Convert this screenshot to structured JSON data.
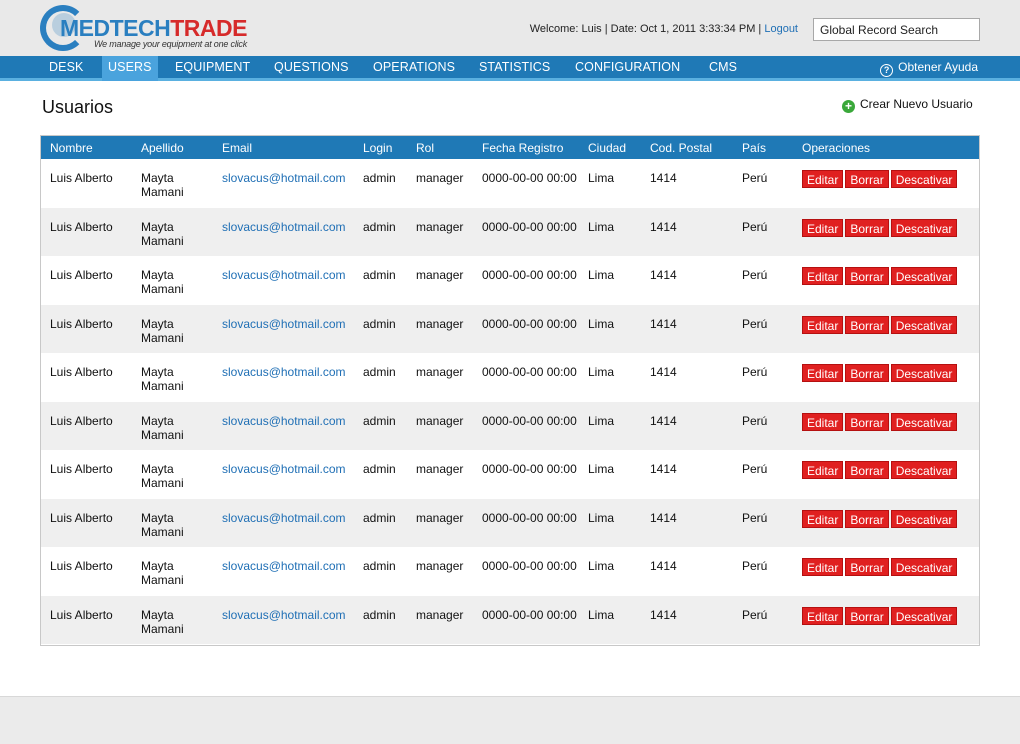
{
  "logo": {
    "brand_main": "MEDTECH",
    "brand_accent": "TRADE",
    "tagline": "We manage your equipment at one click"
  },
  "header": {
    "welcome": "Welcome: Luis | Date: Oct 1, 2011 3:33:34 PM |",
    "logout": "Logout",
    "search_value": "Global Record Search"
  },
  "nav": {
    "items": [
      {
        "label": "DESK"
      },
      {
        "label": "USERS"
      },
      {
        "label": "EQUIPMENT"
      },
      {
        "label": "QUESTIONS"
      },
      {
        "label": "OPERATIONS"
      },
      {
        "label": "STATISTICS"
      },
      {
        "label": "CONFIGURATION"
      },
      {
        "label": "CMS"
      }
    ],
    "active": "USERS",
    "help": "Obtener Ayuda"
  },
  "page": {
    "title": "Usuarios",
    "create_user": "Crear Nuevo Usuario"
  },
  "table": {
    "headers": [
      "Nombre",
      "Apellido",
      "Email",
      "Login",
      "Rol",
      "Fecha Registro",
      "Ciudad",
      "Cod. Postal",
      "País",
      "Operaciones"
    ],
    "ops": {
      "edit": "Editar",
      "delete": "Borrar",
      "deactivate": "Descativar"
    },
    "rows": [
      {
        "nombre": "Luis Alberto",
        "apellido": "Mayta Mamani",
        "email": "slovacus@hotmail.com",
        "login": "admin",
        "rol": "manager",
        "fecha": "0000-00-00 00:00",
        "ciudad": "Lima",
        "postal": "1414",
        "pais": "Perú"
      },
      {
        "nombre": "Luis Alberto",
        "apellido": "Mayta Mamani",
        "email": "slovacus@hotmail.com",
        "login": "admin",
        "rol": "manager",
        "fecha": "0000-00-00 00:00",
        "ciudad": "Lima",
        "postal": "1414",
        "pais": "Perú"
      },
      {
        "nombre": "Luis Alberto",
        "apellido": "Mayta Mamani",
        "email": "slovacus@hotmail.com",
        "login": "admin",
        "rol": "manager",
        "fecha": "0000-00-00 00:00",
        "ciudad": "Lima",
        "postal": "1414",
        "pais": "Perú"
      },
      {
        "nombre": "Luis Alberto",
        "apellido": "Mayta Mamani",
        "email": "slovacus@hotmail.com",
        "login": "admin",
        "rol": "manager",
        "fecha": "0000-00-00 00:00",
        "ciudad": "Lima",
        "postal": "1414",
        "pais": "Perú"
      },
      {
        "nombre": "Luis Alberto",
        "apellido": "Mayta Mamani",
        "email": "slovacus@hotmail.com",
        "login": "admin",
        "rol": "manager",
        "fecha": "0000-00-00 00:00",
        "ciudad": "Lima",
        "postal": "1414",
        "pais": "Perú"
      },
      {
        "nombre": "Luis Alberto",
        "apellido": "Mayta Mamani",
        "email": "slovacus@hotmail.com",
        "login": "admin",
        "rol": "manager",
        "fecha": "0000-00-00 00:00",
        "ciudad": "Lima",
        "postal": "1414",
        "pais": "Perú"
      },
      {
        "nombre": "Luis Alberto",
        "apellido": "Mayta Mamani",
        "email": "slovacus@hotmail.com",
        "login": "admin",
        "rol": "manager",
        "fecha": "0000-00-00 00:00",
        "ciudad": "Lima",
        "postal": "1414",
        "pais": "Perú"
      },
      {
        "nombre": "Luis Alberto",
        "apellido": "Mayta Mamani",
        "email": "slovacus@hotmail.com",
        "login": "admin",
        "rol": "manager",
        "fecha": "0000-00-00 00:00",
        "ciudad": "Lima",
        "postal": "1414",
        "pais": "Perú"
      },
      {
        "nombre": "Luis Alberto",
        "apellido": "Mayta Mamani",
        "email": "slovacus@hotmail.com",
        "login": "admin",
        "rol": "manager",
        "fecha": "0000-00-00 00:00",
        "ciudad": "Lima",
        "postal": "1414",
        "pais": "Perú"
      },
      {
        "nombre": "Luis Alberto",
        "apellido": "Mayta Mamani",
        "email": "slovacus@hotmail.com",
        "login": "admin",
        "rol": "manager",
        "fecha": "0000-00-00 00:00",
        "ciudad": "Lima",
        "postal": "1414",
        "pais": "Perú"
      }
    ]
  },
  "colors": {
    "nav_blue": "#1f79b6",
    "nav_active": "#4aa3dd",
    "link_blue": "#1f6fb5",
    "button_red": "#e02020",
    "brand_red": "#d62a2a"
  }
}
